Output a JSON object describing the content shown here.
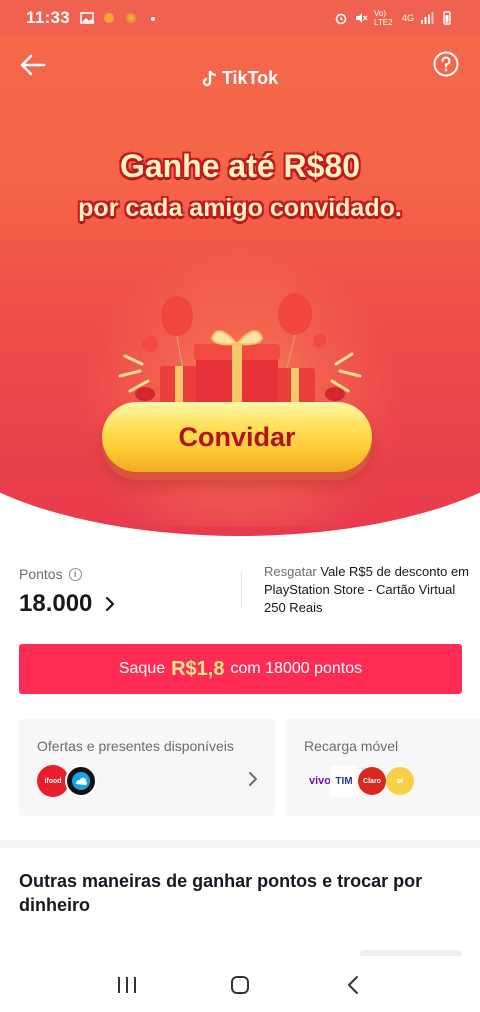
{
  "status_bar": {
    "time": "11:33",
    "network_label": "4G",
    "carrier_label": "Vo) LTE2"
  },
  "header": {
    "brand": "TikTok"
  },
  "hero": {
    "headline_line1": "Ganhe até R$80",
    "headline_line2": "por cada amigo convidado.",
    "invite_button_label": "Convidar"
  },
  "points": {
    "label": "Pontos",
    "value": "18.000"
  },
  "redeem": {
    "prefix": "Resgatar",
    "text": "Vale R$5 de desconto em PlayStation Store - Cartão Virtual 250 Reais"
  },
  "cash_out": {
    "prefix": "Saque",
    "amount": "R$1,8",
    "suffix": "com 18000 pontos"
  },
  "cards": {
    "offers_title": "Ofertas e presentes disponíveis",
    "offers_logos": [
      "ifood",
      "cloud"
    ],
    "recharge_title": "Recarga móvel",
    "recharge_logos": [
      "vivo",
      "TIM",
      "Claro",
      "oi"
    ]
  },
  "section": {
    "title": "Outras maneiras de ganhar pontos e trocar por dinheiro"
  },
  "colors": {
    "accent": "#fe2c55",
    "hero_top": "#f4614a",
    "hero_bottom": "#e83a4d",
    "invite_text": "#b0141a",
    "amount_highlight": "#ffe58a"
  }
}
